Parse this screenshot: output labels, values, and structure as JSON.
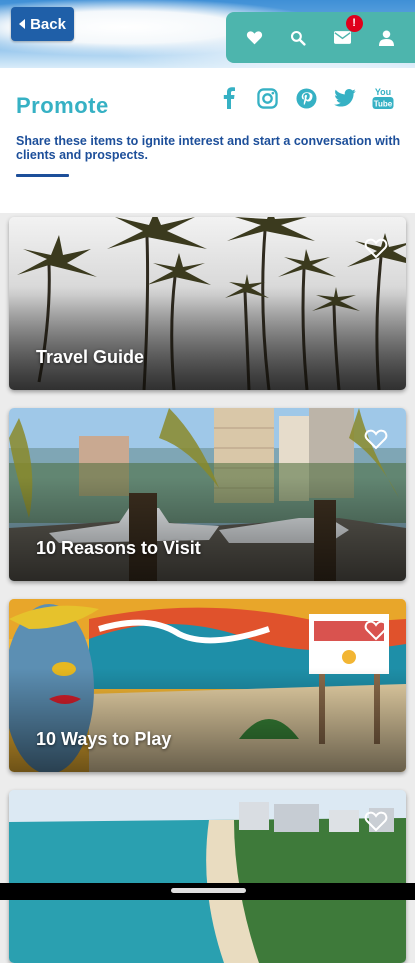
{
  "header": {
    "back_label": "Back",
    "icons": [
      "heart-icon",
      "search-icon",
      "mail-icon",
      "user-icon"
    ],
    "notification_badge": "!"
  },
  "page": {
    "title": "Promote",
    "description": "Share these items to ignite interest and start a conversation with clients and prospects.",
    "socials": [
      "facebook-icon",
      "instagram-icon",
      "pinterest-icon",
      "twitter-icon",
      "youtube-icon"
    ]
  },
  "cards": [
    {
      "title": "Travel Guide"
    },
    {
      "title": "10 Reasons to Visit"
    },
    {
      "title": "10 Ways to Play"
    },
    {
      "title": ""
    }
  ],
  "colors": {
    "accent_teal": "#4db5ad",
    "title_cyan": "#36b1c4",
    "navy": "#1d4f9a",
    "back_blue": "#1f5fa8",
    "badge_red": "#e0001b"
  }
}
